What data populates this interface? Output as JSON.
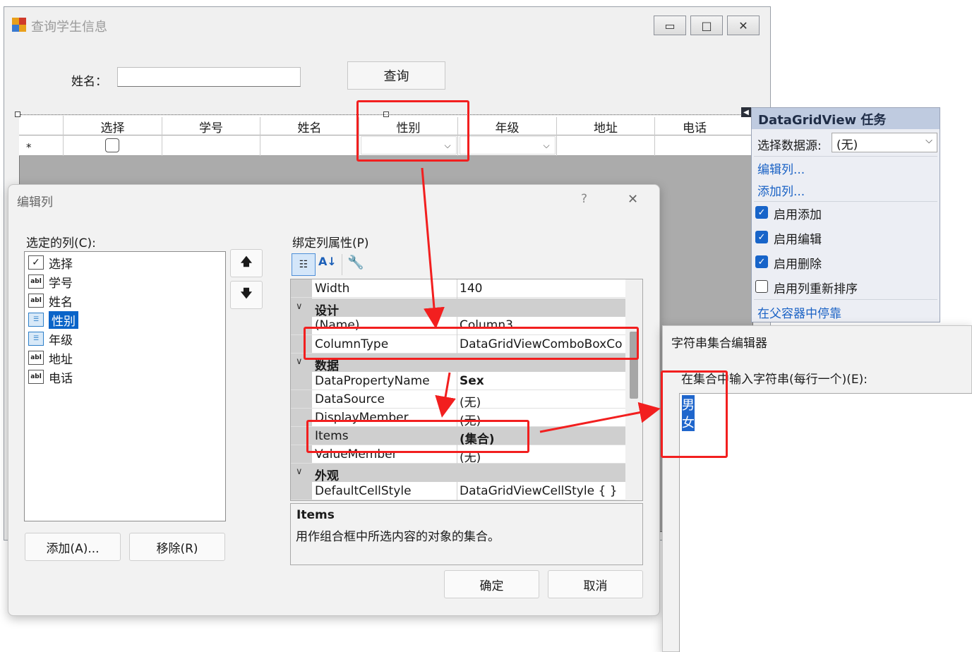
{
  "main_window": {
    "title": "查询学生信息",
    "caption_buttons": {
      "minimize": "▭",
      "maximize": "□",
      "close": "✕"
    },
    "name_label": "姓名：",
    "name_input_value": "",
    "query_button": "查询"
  },
  "grid": {
    "columns": [
      "选择",
      "学号",
      "姓名",
      "性别",
      "年级",
      "地址",
      "电话"
    ],
    "new_row_marker": "*"
  },
  "tasks_panel": {
    "title": "DataGridView 任务",
    "datasource_label": "选择数据源:",
    "datasource_value": "(无)",
    "edit_columns_link": "编辑列...",
    "add_column_link": "添加列...",
    "options": [
      {
        "label": "启用添加",
        "checked": true
      },
      {
        "label": "启用编辑",
        "checked": true
      },
      {
        "label": "启用删除",
        "checked": true
      },
      {
        "label": "启用列重新排序",
        "checked": false
      }
    ],
    "dock_link": "在父容器中停靠"
  },
  "edit_columns": {
    "title": "编辑列",
    "help": "?",
    "close": "✕",
    "selected_columns_label": "选定的列(C):",
    "columns": [
      {
        "name": "选择",
        "icon": "checkbox-column-icon",
        "selected": false
      },
      {
        "name": "学号",
        "icon": "textbox-column-icon",
        "selected": false
      },
      {
        "name": "姓名",
        "icon": "textbox-column-icon",
        "selected": false
      },
      {
        "name": "性别",
        "icon": "combobox-column-icon",
        "selected": true
      },
      {
        "name": "年级",
        "icon": "combobox-column-icon",
        "selected": false
      },
      {
        "name": "地址",
        "icon": "textbox-column-icon",
        "selected": false
      },
      {
        "name": "电话",
        "icon": "textbox-column-icon",
        "selected": false
      }
    ],
    "move_up": "🡅",
    "move_down": "🡇",
    "add_button": "添加(A)...",
    "remove_button": "移除(R)",
    "bound_props_label": "绑定列属性(P)",
    "properties": {
      "width": {
        "name": "Width",
        "value": "140"
      },
      "cat_design": "设计",
      "name_prop": {
        "name": "(Name)",
        "value": "Column3"
      },
      "column_type": {
        "name": "ColumnType",
        "value": "DataGridViewComboBoxCo"
      },
      "cat_data": "数据",
      "data_property_name": {
        "name": "DataPropertyName",
        "value": "Sex"
      },
      "data_source": {
        "name": "DataSource",
        "value": "(无)"
      },
      "display_member": {
        "name": "DisplayMember",
        "value": "(无)"
      },
      "items": {
        "name": "Items",
        "value": "(集合)"
      },
      "value_member": {
        "name": "ValueMember",
        "value": "(无)"
      },
      "cat_appearance": "外观",
      "default_cell_style": {
        "name": "DefaultCellStyle",
        "value": "DataGridViewCellStyle { }"
      }
    },
    "description_title": "Items",
    "description_text": "用作组合框中所选内容的对象的集合。",
    "ok_button": "确定",
    "cancel_button": "取消"
  },
  "string_editor": {
    "title": "字符串集合编辑器",
    "prompt": "在集合中输入字符串(每行一个)(E):",
    "lines": [
      "男",
      "女"
    ]
  },
  "colors": {
    "annotation_red": "#f21f1f",
    "selection_blue": "#0a64c8",
    "link_blue": "#1a62c5"
  }
}
